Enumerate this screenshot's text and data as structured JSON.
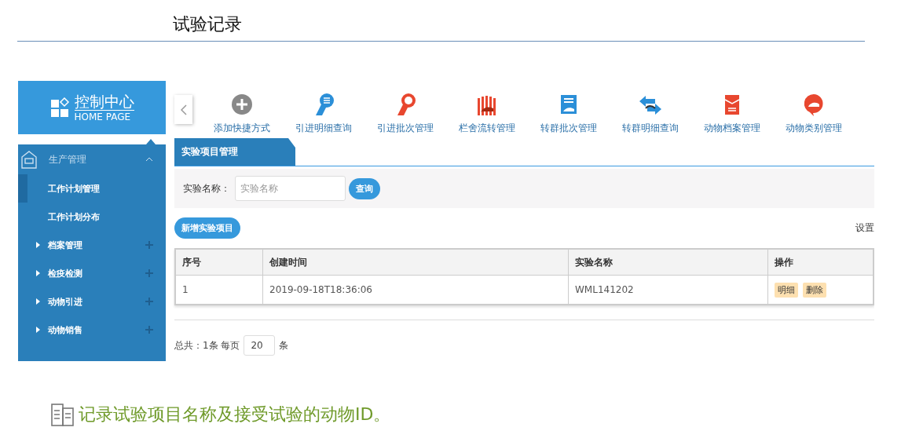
{
  "doc_title": "试验记录",
  "app": {
    "logo": {
      "title": "控制中心",
      "subtitle": "HOME PAGE"
    },
    "sidebar": {
      "sections": [
        {
          "label": "生产管理",
          "expanded": true,
          "children": [
            {
              "label": "工作计划管理",
              "kind": "page",
              "selected": true
            },
            {
              "label": "工作计划分布",
              "kind": "page",
              "selected": false
            },
            {
              "label": "档案管理",
              "kind": "folder",
              "selected": false,
              "expanded": false
            },
            {
              "label": "检疫检测",
              "kind": "folder",
              "selected": false,
              "expanded": false
            },
            {
              "label": "动物引进",
              "kind": "folder",
              "selected": false,
              "expanded": false
            },
            {
              "label": "动物销售",
              "kind": "folder",
              "selected": false,
              "expanded": false
            }
          ]
        }
      ]
    },
    "toolbar": {
      "items": [
        {
          "label": "添加快捷方式"
        },
        {
          "label": "引进明细查询"
        },
        {
          "label": "引进批次管理"
        },
        {
          "label": "栏舍流转管理"
        },
        {
          "label": "转群批次管理"
        },
        {
          "label": "转群明细查询"
        },
        {
          "label": "动物档案管理"
        },
        {
          "label": "动物类别管理"
        }
      ]
    },
    "tabs": [
      {
        "label": "实验项目管理",
        "selected": true
      }
    ],
    "search": {
      "label": "实验名称：",
      "placeholder": "实验名称",
      "button": "查询"
    },
    "add_button": "新增实验项目",
    "settings_link": "设置",
    "table": {
      "columns": [
        "序号",
        "创建时间",
        "实验名称",
        "操作"
      ],
      "rows": [
        {
          "cells": [
            "1",
            "2019-09-18T18:36:06",
            "WML141202"
          ],
          "actions": [
            "明细",
            "删除"
          ]
        }
      ]
    },
    "pagination": {
      "total": "总共：1条 每页",
      "page_size": "20",
      "unit": "条"
    }
  },
  "note": "记录试验项目名称及接受试验的动物ID。"
}
